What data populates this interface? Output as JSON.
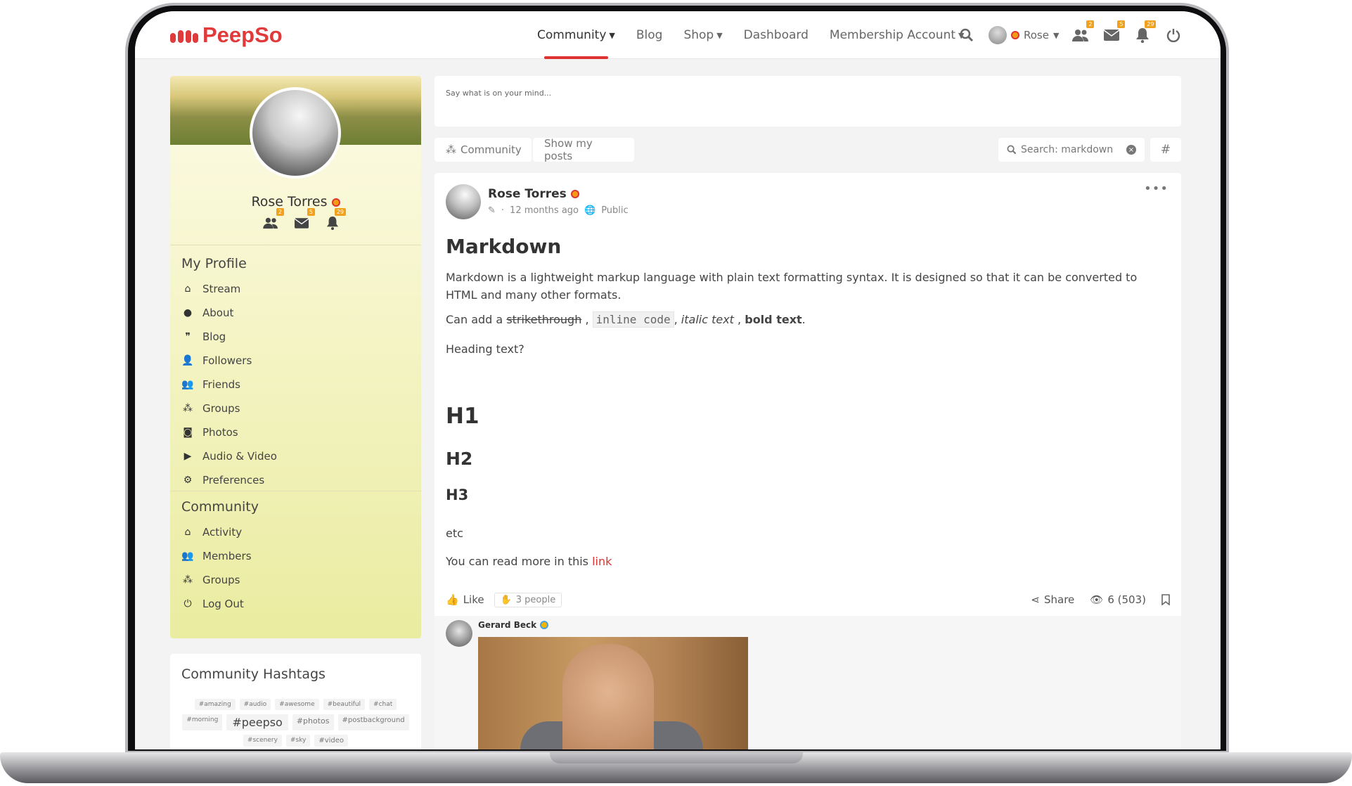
{
  "brand": {
    "name": "PeepSo"
  },
  "nav": {
    "items": [
      {
        "label": "Community",
        "dropdown": true,
        "active": true
      },
      {
        "label": "Blog",
        "dropdown": false
      },
      {
        "label": "Shop",
        "dropdown": true
      },
      {
        "label": "Dashboard",
        "dropdown": false
      },
      {
        "label": "Membership Account",
        "dropdown": true
      }
    ],
    "user_name": "Rose",
    "badges": {
      "friends": "2",
      "messages": "5",
      "notifications": "29"
    }
  },
  "profile": {
    "name": "Rose Torres",
    "badges": {
      "friends": "2",
      "messages": "5",
      "notifications": "29"
    }
  },
  "sidebar": {
    "my_profile_title": "My Profile",
    "my_profile_items": [
      {
        "label": "Stream",
        "icon": "home-icon"
      },
      {
        "label": "About",
        "icon": "user-circle-icon"
      },
      {
        "label": "Blog",
        "icon": "quote-icon"
      },
      {
        "label": "Followers",
        "icon": "user-check-icon"
      },
      {
        "label": "Friends",
        "icon": "users-icon"
      },
      {
        "label": "Groups",
        "icon": "group-icon"
      },
      {
        "label": "Photos",
        "icon": "camera-icon"
      },
      {
        "label": "Audio & Video",
        "icon": "video-icon"
      },
      {
        "label": "Preferences",
        "icon": "gear-icon"
      }
    ],
    "community_title": "Community",
    "community_items": [
      {
        "label": "Activity",
        "icon": "home-icon"
      },
      {
        "label": "Members",
        "icon": "users-icon"
      },
      {
        "label": "Groups",
        "icon": "group-icon"
      },
      {
        "label": "Log Out",
        "icon": "power-icon"
      }
    ]
  },
  "hashtags": {
    "title": "Community Hashtags",
    "tags": [
      "#amazing",
      "#audio",
      "#awesome",
      "#beautiful",
      "#chat",
      "#morning",
      "#peepso",
      "#photos",
      "#postbackground",
      "#scenery",
      "#sky",
      "#video"
    ]
  },
  "composer": {
    "placeholder": "Say what is on your mind..."
  },
  "filters": {
    "community": "Community",
    "show_my_posts": "Show my posts",
    "search": "Search: markdown",
    "hash": "#"
  },
  "post": {
    "author": "Rose Torres",
    "time": "12 months ago",
    "privacy": "Public",
    "title": "Markdown",
    "intro": "Markdown is a lightweight markup language with plain text formatting syntax. It is designed so that it can be converted to HTML and many other formats.",
    "line2": {
      "prefix": "Can add a",
      "strike": "strikethrough",
      "sep1": ",",
      "code": "inline code",
      "sep2": ",",
      "italic": "italic text",
      "sep3": ",",
      "bold": "bold text",
      "end": "."
    },
    "heading_q": "Heading text?",
    "h1": "H1",
    "h2": "H2",
    "h3": "H3",
    "etc": "etc",
    "read_more_prefix": "You can read more in this",
    "link_text": "link",
    "like": "Like",
    "people": "3 people",
    "share": "Share",
    "views": "6 (503)",
    "comment_author": "Gerard Beck"
  }
}
